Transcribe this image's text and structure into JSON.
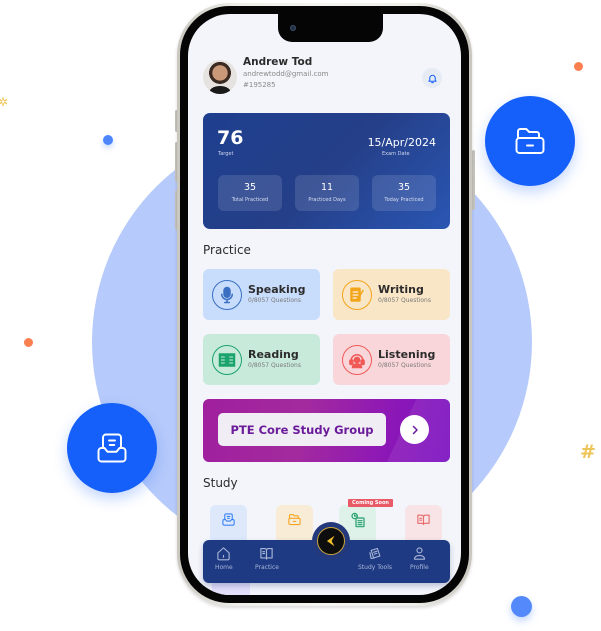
{
  "user": {
    "name": "Andrew Tod",
    "email": "andrewtodd@gmail.com",
    "id": "#195285"
  },
  "stats": {
    "target_value": "76",
    "target_label": "Target",
    "exam_date_value": "15/Apr/2024",
    "exam_date_label": "Exam Date",
    "tiles": [
      {
        "value": "35",
        "label": "Total Practiced"
      },
      {
        "value": "11",
        "label": "Practiced Days"
      },
      {
        "value": "35",
        "label": "Today Practiced"
      }
    ]
  },
  "practice": {
    "title": "Practice",
    "cards": [
      {
        "title": "Speaking",
        "subtitle": "0/8057 Questions",
        "icon": "microphone-icon",
        "color": "#3a6fc2",
        "bg": "#c8dcfb"
      },
      {
        "title": "Writing",
        "subtitle": "0/8057 Questions",
        "icon": "writing-icon",
        "color": "#f2a51b",
        "bg": "#f9e6c6"
      },
      {
        "title": "Reading",
        "subtitle": "0/8057 Questions",
        "icon": "book-icon",
        "color": "#1aa36b",
        "bg": "#c8eadb"
      },
      {
        "title": "Listening",
        "subtitle": "0/8057 Questions",
        "icon": "headset-icon",
        "color": "#ef5a57",
        "bg": "#f9d6da"
      }
    ]
  },
  "banner": {
    "label": "PTE Core Study Group"
  },
  "study": {
    "title": "Study",
    "coming_soon_label": "Coming Soon",
    "tiles": [
      {
        "icon": "inbox-icon",
        "color": "#3b82f6",
        "bg": "#dde8fb"
      },
      {
        "icon": "folder-icon",
        "color": "#f5a623",
        "bg": "#f8ecd6"
      },
      {
        "icon": "schedule-icon",
        "color": "#22a06b",
        "bg": "#dff2ea"
      },
      {
        "icon": "open-book-icon",
        "color": "#e86a6a",
        "bg": "#f8e3e6"
      }
    ]
  },
  "nav": {
    "items": [
      {
        "label": "Home",
        "icon": "home-icon"
      },
      {
        "label": "Practice",
        "icon": "book-icon"
      },
      {
        "label": "Study Tools",
        "icon": "study-tools-icon"
      },
      {
        "label": "Profile",
        "icon": "profile-icon"
      }
    ]
  },
  "colors": {
    "brand_blue": "#1560fb",
    "navbar": "#1e3a82",
    "banner_purple": "#9a1fa8",
    "blob": "#b6cafb"
  }
}
